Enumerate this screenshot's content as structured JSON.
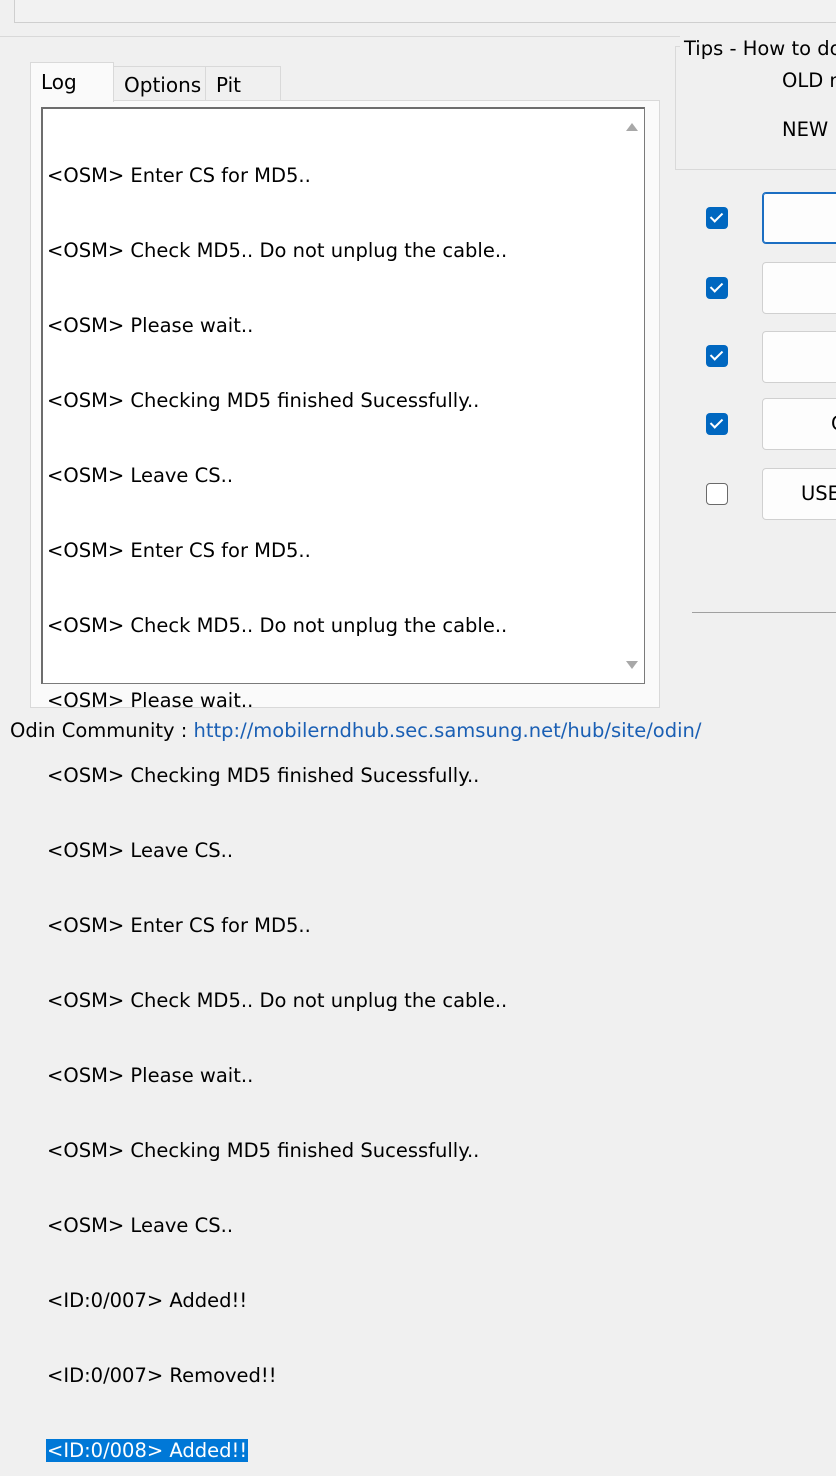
{
  "tabs": [
    {
      "label": "Log",
      "active": true
    },
    {
      "label": "Options",
      "active": false
    },
    {
      "label": "Pit",
      "active": false
    }
  ],
  "log": {
    "lines": [
      "<OSM> Enter CS for MD5..",
      "<OSM> Check MD5.. Do not unplug the cable..",
      "<OSM> Please wait..",
      "<OSM> Checking MD5 finished Sucessfully..",
      "<OSM> Leave CS..",
      "<OSM> Enter CS for MD5..",
      "<OSM> Check MD5.. Do not unplug the cable..",
      "<OSM> Please wait..",
      "<OSM> Checking MD5 finished Sucessfully..",
      "<OSM> Leave CS..",
      "<OSM> Enter CS for MD5..",
      "<OSM> Check MD5.. Do not unplug the cable..",
      "<OSM> Please wait..",
      "<OSM> Checking MD5 finished Sucessfully..",
      "<OSM> Leave CS..",
      "<ID:0/007> Added!!",
      "<ID:0/007> Removed!!",
      "<ID:0/008> Added!!"
    ],
    "selected_line": "<ID:0/008> Added!!"
  },
  "tips": {
    "title": "Tips - How to do",
    "old_text": "OLD n",
    "new_text": "NEW",
    "new_accent": "r"
  },
  "file_rows": [
    {
      "checked": true,
      "label": ""
    },
    {
      "checked": true,
      "label": ""
    },
    {
      "checked": true,
      "label": ""
    },
    {
      "checked": true,
      "label": "C"
    },
    {
      "checked": false,
      "label": "USE"
    }
  ],
  "footer": {
    "label": "Odin Community : ",
    "url": "http://mobilerndhub.sec.samsung.net/hub/site/odin/"
  },
  "colors": {
    "selection": "#0078d7",
    "checkbox_on": "#0067c0",
    "link": "#1a5fb4",
    "accent_red": "#dd1111"
  }
}
